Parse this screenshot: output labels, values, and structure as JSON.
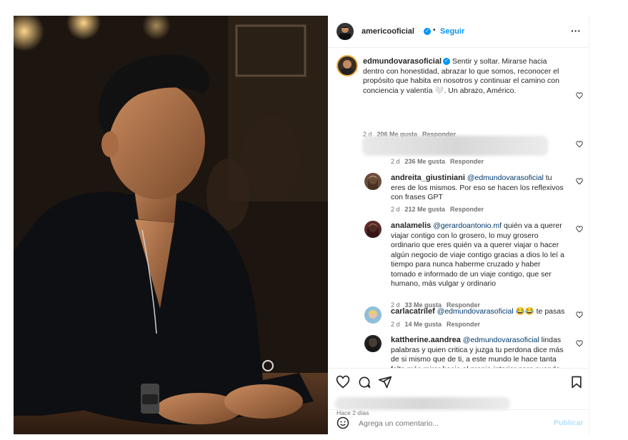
{
  "post": {
    "author": "americooficial",
    "follow_label": "Seguir",
    "more_label": "···",
    "time_ago": "Hace 2 días"
  },
  "comments": [
    {
      "user": "edmundovarasoficial",
      "text": "Sentir y soltar. Mirarse hacia dentro con honestidad, abrazar lo que somos, reconocer el propósito que habita en nosotros y continuar el camino con conciencia y valentía 🤍. Un abrazo, Américo.",
      "age": "2 d",
      "likes": "206 Me gusta",
      "reply": "Responder"
    },
    {
      "user": "",
      "text": "",
      "age": "2 d",
      "likes": "236 Me gusta",
      "reply": "Responder"
    },
    {
      "user": "andreita_giustiniani",
      "mention": "@edmundovarasoficial",
      "text": "tu eres de los mismos. Por eso se hacen los reflexivos con frases GPT",
      "age": "2 d",
      "likes": "212 Me gusta",
      "reply": "Responder"
    },
    {
      "user": "analamelis",
      "mention": "@gerardoantonio.mf",
      "text": "quién va a querer viajar contigo con lo grosero, lo muy grosero ordinario que eres quién va a querer viajar o hacer algún negocio de viaje contigo gracias a dios lo leí a tiempo para nunca haberme cruzado y haber tomado e informado de un viaje contigo, que ser humano, más vulgar y ordinario",
      "age": "2 d",
      "likes": "33 Me gusta",
      "reply": "Responder"
    },
    {
      "user": "carlacatrilef",
      "mention": "@edmundovarasoficial",
      "text": "😂😂 te pasas",
      "age": "2 d",
      "likes": "14 Me gusta",
      "reply": "Responder"
    },
    {
      "user": "kattherine.aandrea",
      "mention": "@edmundovarasoficial",
      "text": "lindas palabras y quien critica y juzga tu perdona dice más de si mismo que de ti, a este mundo le hace tanta falta más mirar hacia el propio interior para cuando",
      "age": "",
      "likes": "",
      "reply": ""
    }
  ],
  "composer": {
    "emoji_icon": "smiley-icon",
    "placeholder": "Agrega un comentario...",
    "publish_label": "Publicar"
  },
  "colors": {
    "accent": "#0095f6",
    "mention": "#00376b",
    "publish_disabled": "#b2dffc"
  }
}
